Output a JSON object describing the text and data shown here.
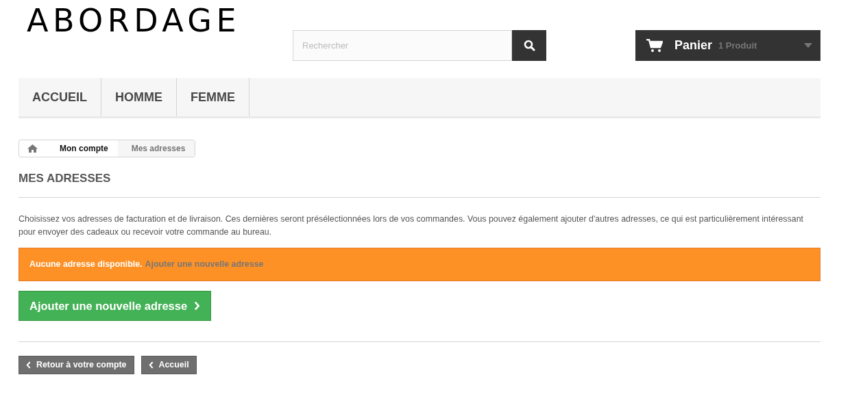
{
  "logo": {
    "text": "ABORDAGE"
  },
  "search": {
    "placeholder": "Rechercher"
  },
  "cart": {
    "label": "Panier",
    "count": "1 Produit"
  },
  "menu": [
    "ACCUEIL",
    "HOMME",
    "FEMME"
  ],
  "breadcrumb": [
    {
      "kind": "home"
    },
    {
      "kind": "link",
      "label": "Mon compte"
    },
    {
      "kind": "current",
      "label": "Mes adresses"
    }
  ],
  "heading": "MES ADRESSES",
  "intro": "Choisissez vos adresses de facturation et de livraison. Ces dernières seront présélectionnées lors de vos commandes. Vous pouvez également ajouter d'autres adresses, ce qui est particulièrement intéressant pour envoyer des cadeaux ou recevoir votre commande au bureau.",
  "alert": {
    "message": "Aucune adresse disponible.",
    "link": "Ajouter une nouvelle adresse"
  },
  "add_button": "Ajouter une nouvelle adresse",
  "footer_buttons": [
    "Retour à votre compte",
    "Accueil"
  ]
}
